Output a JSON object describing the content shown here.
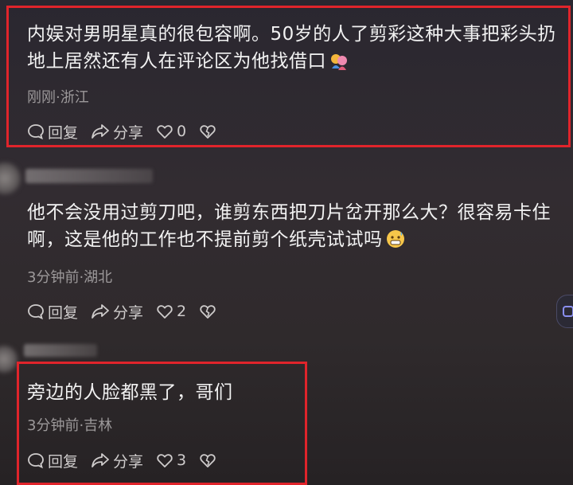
{
  "comments": [
    {
      "text": "内娱对男明星真的很包容啊。50岁的人了剪彩这种大事把彩头扔地上居然还有人在评论区为他找借口",
      "meta": "刚刚·浙江",
      "reply_label": "回复",
      "share_label": "分享",
      "likes": "0",
      "highlighted": true
    },
    {
      "text": "他不会没用过剪刀吧，谁剪东西把刀片岔开那么大？很容易卡住啊，这是他的工作也不提前剪个纸壳试试吗",
      "meta": "3分钟前·湖北",
      "reply_label": "回复",
      "share_label": "分享",
      "likes": "2",
      "highlighted": false
    },
    {
      "text": "旁边的人脸都黑了，哥们",
      "meta": "3分钟前·吉林",
      "reply_label": "回复",
      "share_label": "分享",
      "likes": "3",
      "highlighted": true
    }
  ],
  "colors": {
    "highlight": "#e0242b",
    "meta_text": "#9c999a",
    "body_text": "#f2f2f2"
  },
  "icons": [
    "comment-bubble-icon",
    "share-arrow-icon",
    "heart-icon",
    "broken-heart-icon",
    "couple-emoji",
    "grimace-sweat-emoji"
  ]
}
